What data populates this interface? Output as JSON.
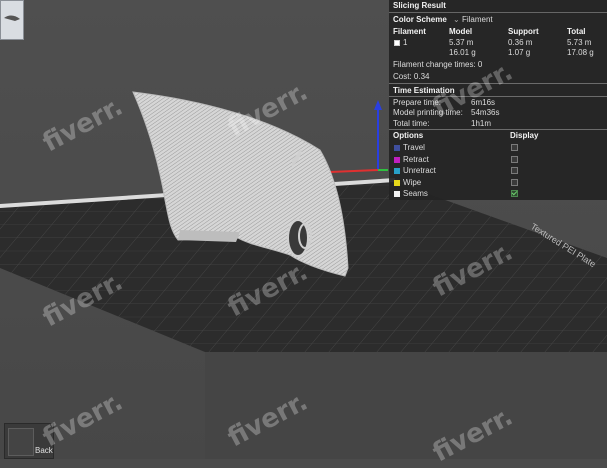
{
  "panel": {
    "title": "Slicing Result",
    "color_scheme_label": "Color Scheme",
    "color_scheme_value": "Filament",
    "columns": [
      "Filament",
      "Model",
      "Support",
      "Total"
    ],
    "filament": {
      "id": "1",
      "model_length": "5.37 m",
      "model_weight": "16.01 g",
      "support_length": "0.36 m",
      "support_weight": "1.07 g",
      "total_length": "5.73 m",
      "total_weight": "17.08 g"
    },
    "change_times": "Filament change times: 0",
    "cost": "Cost: 0.34",
    "time_title": "Time Estimation",
    "prepare_label": "Prepare time:",
    "prepare_value": "6m16s",
    "model_time_label": "Model printing time:",
    "model_time_value": "54m36s",
    "total_time_label": "Total time:",
    "total_time_value": "1h1m",
    "options_label": "Options",
    "display_label": "Display",
    "options": [
      {
        "label": "Travel",
        "color": "#3f4f9e",
        "checked": false
      },
      {
        "label": "Retract",
        "color": "#c020c0",
        "checked": false
      },
      {
        "label": "Unretract",
        "color": "#28a0c8",
        "checked": false
      },
      {
        "label": "Wipe",
        "color": "#e6d81a",
        "checked": false
      },
      {
        "label": "Seams",
        "color": "#f0f0f0",
        "checked": true
      }
    ]
  },
  "plate_label": "Textured PEI Plate",
  "back_label": "Back",
  "watermark": "fiverr."
}
